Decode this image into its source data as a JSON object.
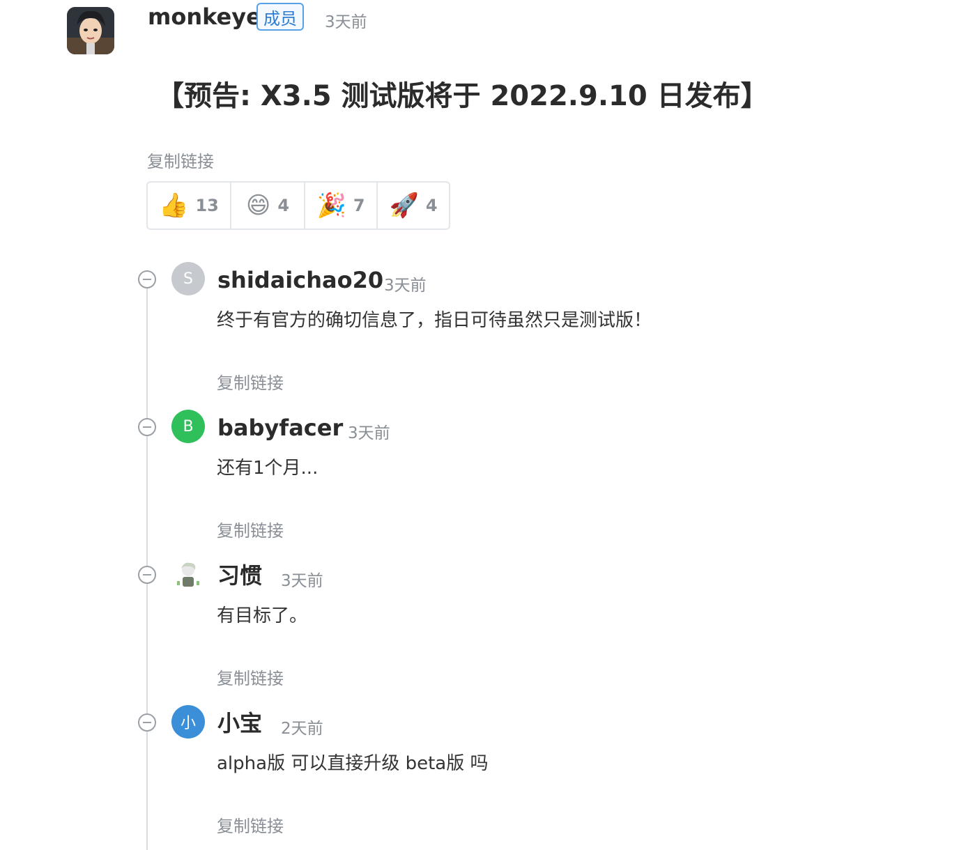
{
  "post": {
    "author": "monkeye",
    "badge": "成员",
    "time": "3天前",
    "title": "【预告: X3.5 测试版将于 2022.9.10 日发布】",
    "copy_link": "复制链接",
    "reactions": [
      {
        "icon": "thumbs-up",
        "emoji": "👍",
        "count": "13"
      },
      {
        "icon": "grinning-face",
        "emoji": "😄",
        "count": "4"
      },
      {
        "icon": "party-popper",
        "emoji": "🎉",
        "count": "7"
      },
      {
        "icon": "rocket",
        "emoji": "🚀",
        "count": "4"
      }
    ]
  },
  "comments": [
    {
      "author": "shidaichao20",
      "avatar_letter": "S",
      "avatar_color": "#c6c9ce",
      "time": "3天前",
      "body": "终于有官方的确切信息了，指日可待虽然只是测试版！",
      "copy_link": "复制链接"
    },
    {
      "author": "babyfacer",
      "avatar_letter": "B",
      "avatar_color": "#2fbf5b",
      "time": "3天前",
      "body": "还有1个月...",
      "copy_link": "复制链接"
    },
    {
      "author": "习惯",
      "avatar_letter": "",
      "avatar_color": "#ffffff",
      "time": "3天前",
      "body": "有目标了。",
      "copy_link": "复制链接"
    },
    {
      "author": "小宝",
      "avatar_letter": "小",
      "avatar_color": "#3a8fd8",
      "time": "2天前",
      "body": "alpha版 可以直接升级 beta版 吗",
      "copy_link": "复制链接"
    }
  ]
}
